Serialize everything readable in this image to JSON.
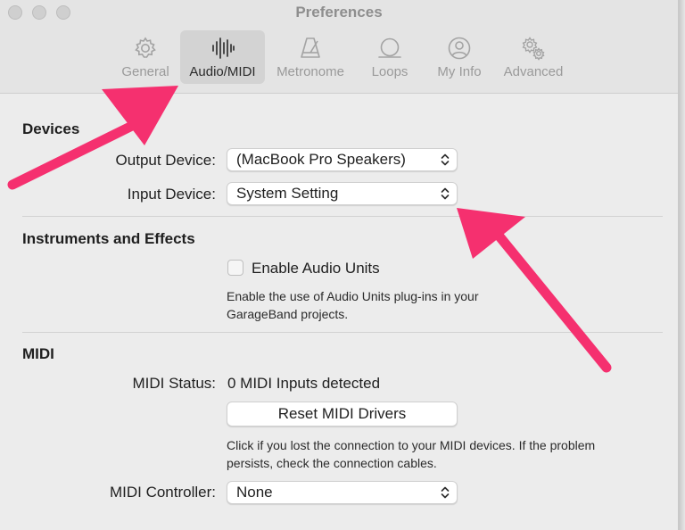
{
  "window": {
    "title": "Preferences"
  },
  "toolbar": {
    "tabs": [
      {
        "label": "General",
        "icon": "gear-icon"
      },
      {
        "label": "Audio/MIDI",
        "icon": "waveform-icon",
        "selected": true
      },
      {
        "label": "Metronome",
        "icon": "metronome-icon"
      },
      {
        "label": "Loops",
        "icon": "loop-icon"
      },
      {
        "label": "My Info",
        "icon": "person-icon"
      },
      {
        "label": "Advanced",
        "icon": "gears-icon"
      }
    ]
  },
  "devices": {
    "heading": "Devices",
    "output_label": "Output Device:",
    "output_value": "(MacBook Pro Speakers)",
    "input_label": "Input Device:",
    "input_value": "System Setting"
  },
  "instruments": {
    "heading": "Instruments and Effects",
    "checkbox_label": "Enable Audio Units",
    "checkbox_checked": false,
    "description_line1": "Enable the use of Audio Units plug-ins in your",
    "description_line2": "GarageBand projects."
  },
  "midi": {
    "heading": "MIDI",
    "status_label": "MIDI Status:",
    "status_value": "0 MIDI Inputs detected",
    "reset_button": "Reset MIDI Drivers",
    "help_line1": "Click if you lost the connection to your MIDI devices. If the problem",
    "help_line2": "persists, check the connection cables.",
    "controller_label": "MIDI Controller:",
    "controller_value": "None"
  },
  "annotations": {
    "arrow_color": "#f5306f"
  }
}
